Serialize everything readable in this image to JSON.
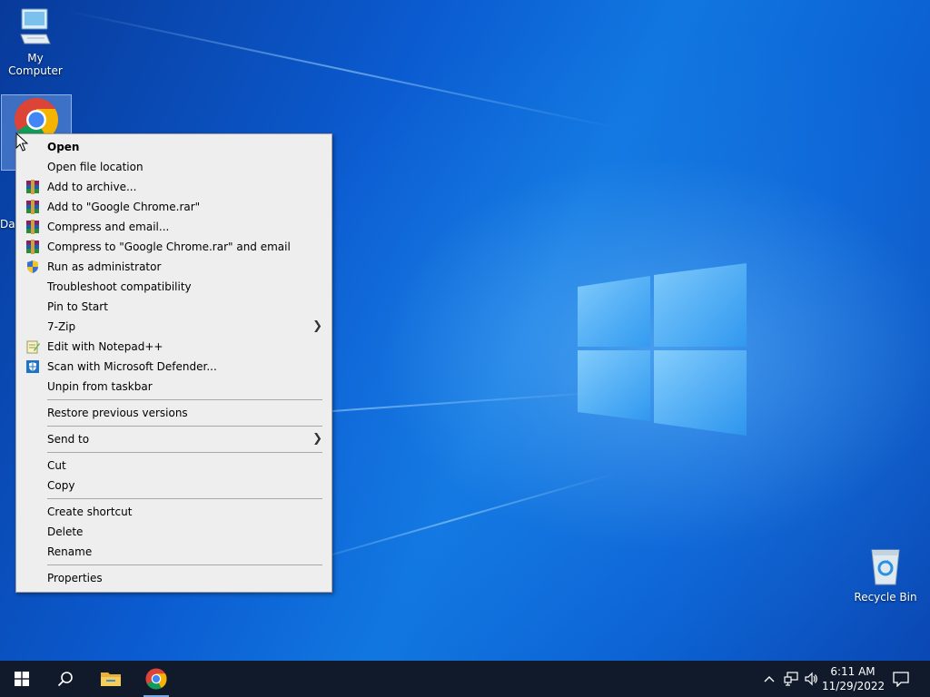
{
  "desktop": {
    "icons": [
      {
        "label": "My Computer"
      },
      {
        "label": "Recycle Bin"
      },
      {
        "label": "Da"
      }
    ]
  },
  "context_menu": {
    "items": [
      {
        "label": "Open",
        "bold": true
      },
      {
        "label": "Open file location"
      },
      {
        "label": "Add to archive...",
        "icon": "winrar-icon"
      },
      {
        "label": "Add to \"Google Chrome.rar\"",
        "icon": "winrar-icon"
      },
      {
        "label": "Compress and email...",
        "icon": "winrar-icon"
      },
      {
        "label": "Compress to \"Google Chrome.rar\" and email",
        "icon": "winrar-icon"
      },
      {
        "label": "Run as administrator",
        "icon": "uac-shield-icon"
      },
      {
        "label": "Troubleshoot compatibility"
      },
      {
        "label": "Pin to Start"
      },
      {
        "label": "7-Zip",
        "submenu": true
      },
      {
        "label": "Edit with Notepad++",
        "icon": "notepadpp-icon"
      },
      {
        "label": "Scan with Microsoft Defender...",
        "icon": "defender-icon"
      },
      {
        "label": "Unpin from taskbar"
      },
      {
        "label": "Restore previous versions"
      },
      {
        "label": "Send to",
        "submenu": true
      },
      {
        "label": "Cut"
      },
      {
        "label": "Copy"
      },
      {
        "label": "Create shortcut"
      },
      {
        "label": "Delete"
      },
      {
        "label": "Rename"
      },
      {
        "label": "Properties"
      }
    ]
  },
  "taskbar": {
    "clock_time": "6:11 AM",
    "clock_date": "11/29/2022",
    "pinned": [
      "start-icon",
      "search-icon",
      "file-explorer-icon",
      "chrome-icon"
    ],
    "tray": [
      "show-hidden-icons-icon",
      "network-icon",
      "volume-icon",
      "action-center-icon"
    ]
  },
  "colors": {
    "taskbar_bg": "#101a2a",
    "menu_bg": "#eeeeee",
    "menu_separator": "#a8a8a8",
    "desktop_blue": "#0b5bd0"
  }
}
